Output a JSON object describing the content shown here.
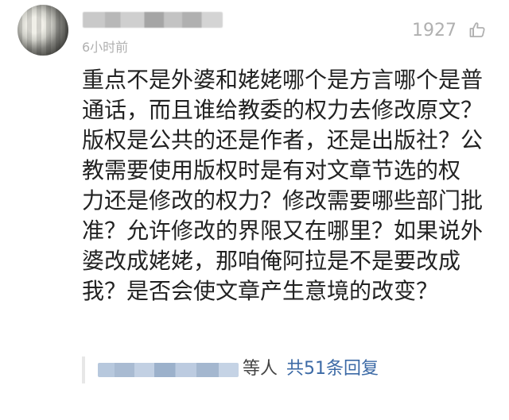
{
  "comment": {
    "time": "6小时前",
    "likes": "1927",
    "like_icon": "thumbs-up-icon",
    "body_lines": [
      "重点不是外婆和姥姥哪个是方言哪个是普",
      "通话，而且谁给教委的权力去修改原文？",
      "版权是公共的还是作者，还是出版社？公",
      "教需要使用版权时是有对文章节选的权",
      "力还是修改的权力？修改需要哪些部门批",
      "准？允许修改的界限又在哪里？如果说外",
      "婆改成姥姥，那咱俺阿拉是不是要改成",
      "我？是否会使文章产生意境的改变？"
    ]
  },
  "reply_summary": {
    "and_others": "等人",
    "reply_count": "共51条回复"
  },
  "colors": {
    "text_primary": "#222222",
    "text_secondary": "#b0b0b0",
    "link": "#3c6aa6"
  }
}
